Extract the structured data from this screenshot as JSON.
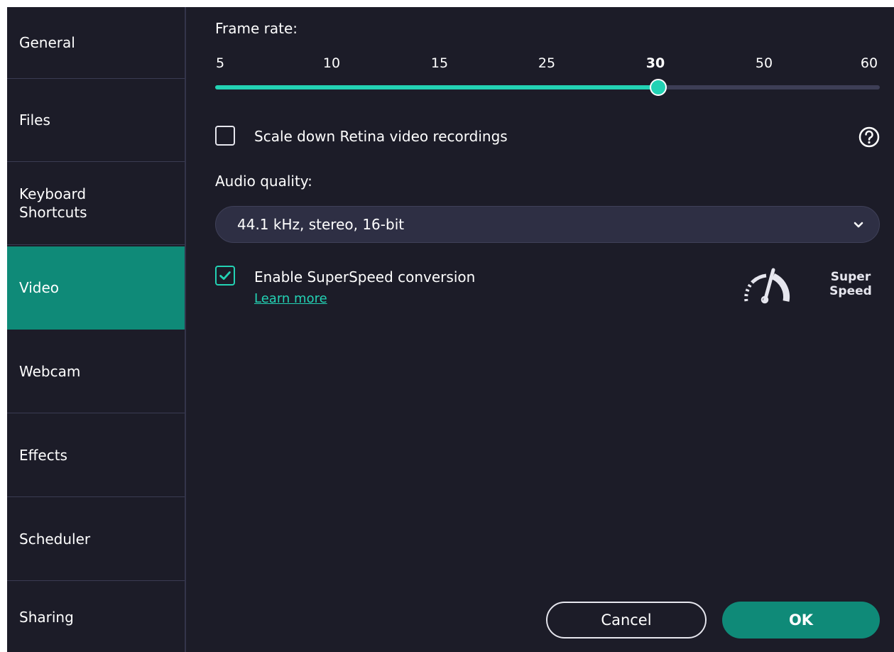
{
  "sidebar": {
    "items": [
      {
        "label": "General",
        "active": false
      },
      {
        "label": "Files",
        "active": false
      },
      {
        "label": "Keyboard\nShortcuts",
        "active": false
      },
      {
        "label": "Video",
        "active": true
      },
      {
        "label": "Webcam",
        "active": false
      },
      {
        "label": "Effects",
        "active": false
      },
      {
        "label": "Scheduler",
        "active": false
      },
      {
        "label": "Sharing",
        "active": false
      }
    ]
  },
  "video": {
    "frame_rate_label": "Frame rate:",
    "frame_rate_ticks": [
      "5",
      "10",
      "15",
      "25",
      "30",
      "50",
      "60"
    ],
    "frame_rate_selected": "30",
    "frame_rate_position_fraction": 0.6667,
    "scale_down_label": "Scale down Retina video recordings",
    "scale_down_checked": false,
    "audio_quality_label": "Audio quality:",
    "audio_quality_value": "44.1 kHz, stereo, 16-bit",
    "superspeed_label": "Enable SuperSpeed conversion",
    "superspeed_checked": true,
    "learn_more": "Learn more",
    "superspeed_badge": "Super\nSpeed"
  },
  "footer": {
    "cancel_label": "Cancel",
    "ok_label": "OK"
  },
  "colors": {
    "background": "#1c1c28",
    "accent": "#23d2b4",
    "active_item": "#0f8a78",
    "track": "#3d3e56"
  },
  "icons": {
    "help": "question-circle-icon",
    "dropdown": "chevron-down-icon",
    "check": "checkmark-icon",
    "superspeed": "speedometer-icon"
  }
}
